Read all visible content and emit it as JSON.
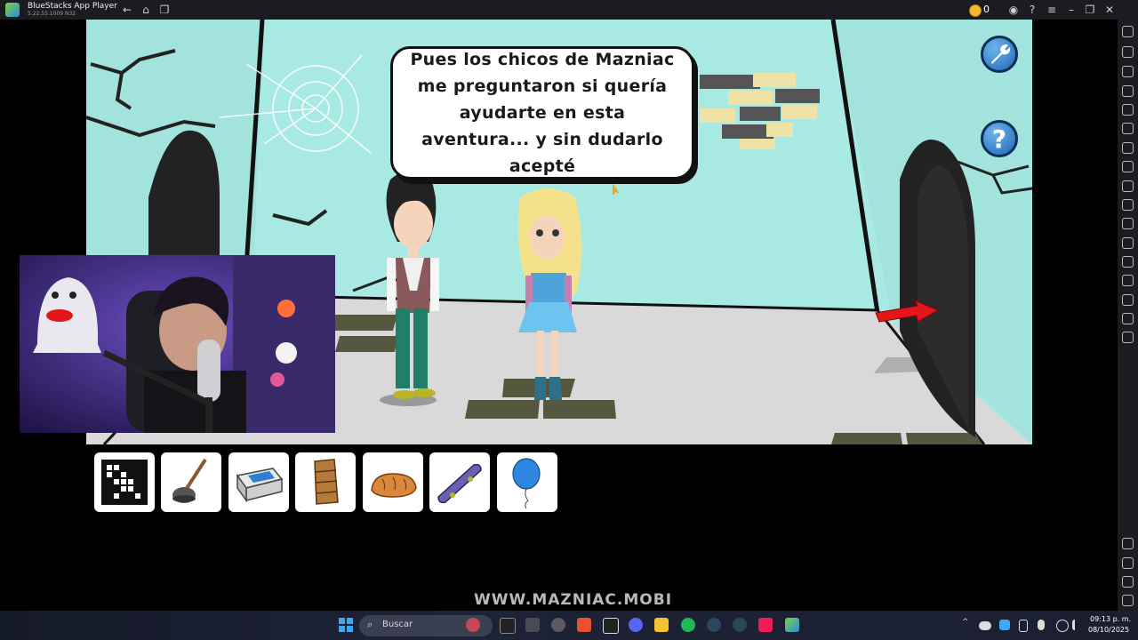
{
  "window": {
    "title": "BlueStacks App Player",
    "version": "5.22.55.1009  N32",
    "coins": "0"
  },
  "game": {
    "dialogue": "Pues los chicos de Mazniac me preguntaron si quería ayudarte en esta aventura... y sin dudarlo acepté",
    "settings_icon": "wrench-icon",
    "help_label": "?"
  },
  "inventory": [
    {
      "name": "crossword-map"
    },
    {
      "name": "plunger"
    },
    {
      "name": "tablet-box"
    },
    {
      "name": "wooden-drawer"
    },
    {
      "name": "bread-loaf"
    },
    {
      "name": "skateboard"
    },
    {
      "name": "blue-balloon"
    }
  ],
  "watermark": "WWW.MAZNIAC.MOBI",
  "taskbar": {
    "search_label": "Buscar",
    "time": "09:13 p. m.",
    "date": "08/10/2025"
  },
  "colors": {
    "wall": "#a9e9e3",
    "floor": "#d9d9d9",
    "accent_red": "#e3161b",
    "button_blue": "#2f7fd0"
  }
}
